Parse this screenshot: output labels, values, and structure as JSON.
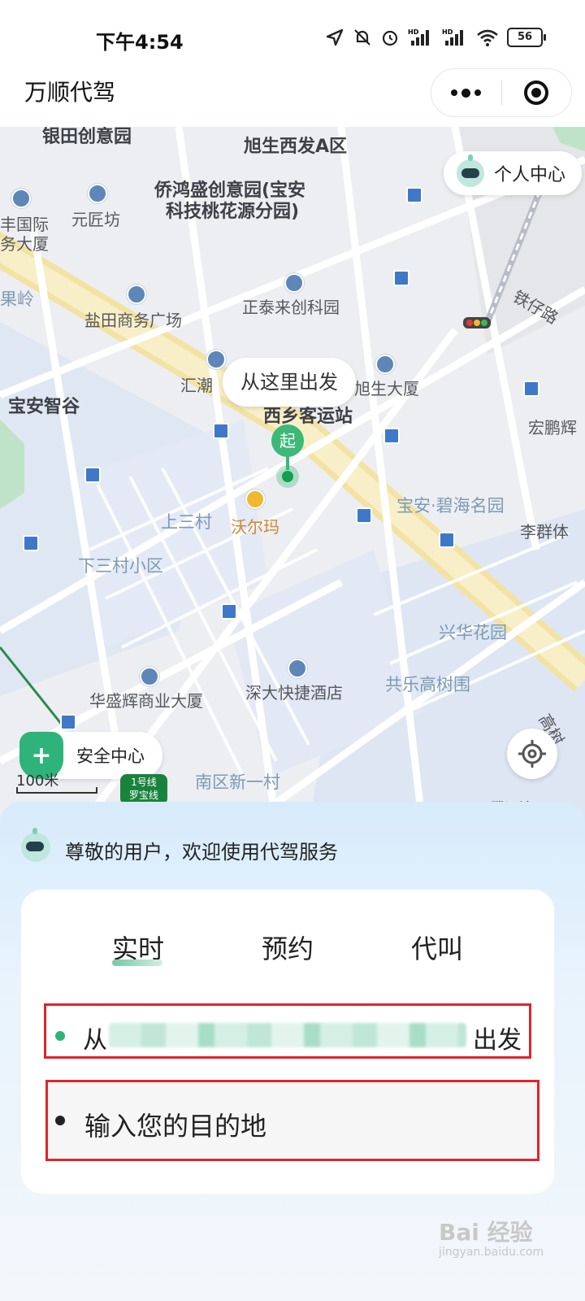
{
  "status_bar": {
    "time": "下午4:54",
    "battery": "56"
  },
  "header": {
    "title": "万顺代驾"
  },
  "map": {
    "callout": "从这里出发",
    "start_marker": "起",
    "personal_center": "个人中心",
    "safety_center": "安全中心",
    "scale": "100米",
    "metro_line": "1号线\n罗宝线",
    "attribution": "腾讯地图",
    "labels": [
      "银田创意园",
      "旭生西发A区",
      "侨鸿盛创意园(宝安",
      "科技桃花源分园)",
      "丰国际",
      "务大厦",
      "元匠坊",
      "果岭",
      "盐田商务广场",
      "正泰来创科园",
      "铁仔路",
      "汇潮",
      "旭生大厦",
      "宝安智谷",
      "西乡客运站",
      "宏鹏辉",
      "上三村",
      "沃尔玛",
      "宝安·碧海名园",
      "李群体",
      "下三村小区",
      "兴华花园",
      "华盛辉商业大厦",
      "深大快捷酒店",
      "共乐高树围",
      "南区新一村",
      "高树"
    ]
  },
  "panel": {
    "welcome": "尊敬的用户，欢迎使用代驾服务",
    "tabs": [
      "实时",
      "预约",
      "代叫"
    ],
    "from_prefix": "从",
    "from_suffix": "出发",
    "to_placeholder": "输入您的目的地"
  },
  "watermark": {
    "main": "Bai 经验",
    "sub": "jingyan.baidu.com"
  },
  "colors": {
    "accent": "#2eb37a",
    "highlight": "#e0242b"
  }
}
